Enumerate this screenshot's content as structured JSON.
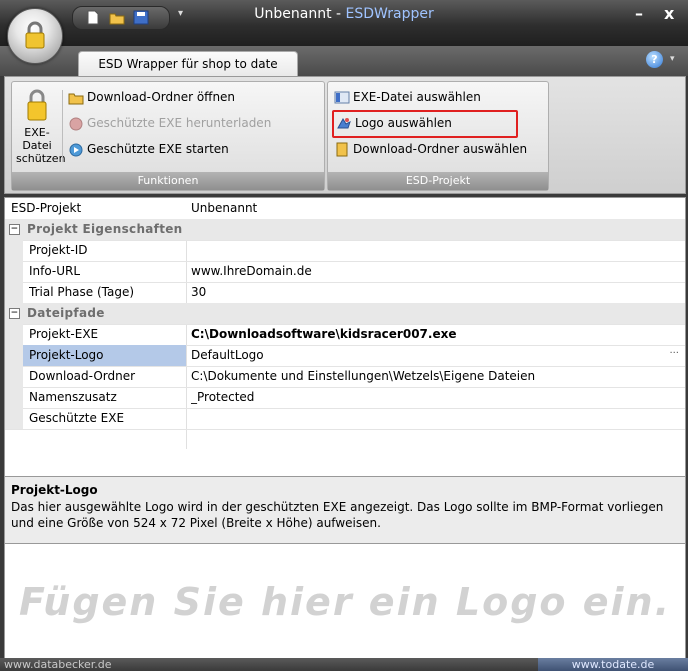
{
  "window": {
    "title_prefix": "Unbenannt - ",
    "title_app": "ESDWrapper",
    "minimize": "–",
    "close": "x"
  },
  "ribbon_tab": "ESD Wrapper für shop to date",
  "help_label": "?",
  "groups": {
    "funktionen": {
      "label": "Funktionen",
      "big_button": "EXE-Datei schützen",
      "download_open": "Download-Ordner öffnen",
      "download_protected": "Geschützte EXE herunterladen",
      "start_protected": "Geschützte EXE starten"
    },
    "esd_projekt": {
      "label": "ESD-Projekt",
      "select_exe": "EXE-Datei auswählen",
      "select_logo": "Logo auswählen",
      "select_download_folder": "Download-Ordner auswählen"
    }
  },
  "grid": {
    "header_name": "ESD-Projekt",
    "header_value": "Unbenannt",
    "categories": {
      "eigenschaften": "Projekt Eigenschaften",
      "dateipfade": "Dateipfade"
    },
    "rows": {
      "projekt_id": {
        "name": "Projekt-ID",
        "value": ""
      },
      "info_url": {
        "name": "Info-URL",
        "value": "www.IhreDomain.de"
      },
      "trial": {
        "name": "Trial Phase (Tage)",
        "value": "30"
      },
      "projekt_exe": {
        "name": "Projekt-EXE",
        "value": "C:\\Downloadsoftware\\kidsracer007.exe"
      },
      "projekt_logo": {
        "name": "Projekt-Logo",
        "value": "DefaultLogo",
        "button": "..."
      },
      "download_ordner": {
        "name": "Download-Ordner",
        "value": "C:\\Dokumente und Einstellungen\\Wetzels\\Eigene Dateien"
      },
      "namenszusatz": {
        "name": "Namenszusatz",
        "value": "_Protected"
      },
      "geschuetzte_exe": {
        "name": "Geschützte EXE",
        "value": ""
      }
    }
  },
  "description": {
    "title": "Projekt-Logo",
    "text": "Das hier ausgewählte Logo wird in der geschützten EXE angezeigt. Das Logo sollte im BMP-Format vorliegen und eine Größe von 524 x 72 Pixel (Breite x Höhe) aufweisen."
  },
  "logo_placeholder": "Fügen Sie hier ein Logo ein.",
  "status": {
    "left": "www.databecker.de",
    "right": "www.todate.de"
  },
  "colors": {
    "selected_row": "#b4c9e8",
    "highlight_border": "#e02020",
    "title_app": "#9fc3ff"
  }
}
